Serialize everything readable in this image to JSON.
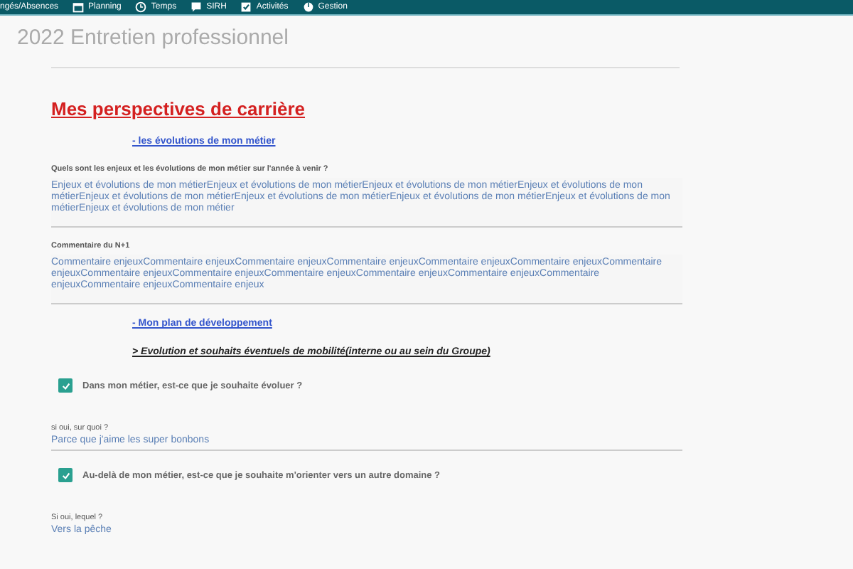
{
  "nav": {
    "items": [
      {
        "label": "ngés/Absences"
      },
      {
        "label": "Planning"
      },
      {
        "label": "Temps"
      },
      {
        "label": "SIRH"
      },
      {
        "label": "Activités"
      },
      {
        "label": "Gestion"
      }
    ]
  },
  "page_title": "2022 Entretien professionnel",
  "heading": "Mes perspectives de carrière",
  "blocks": [
    {
      "kind": "link",
      "text": "- les évolutions de mon métier"
    },
    {
      "kind": "textarea",
      "label": "Quels sont les enjeux et les évolutions de mon métier sur l'année à venir ?",
      "value": "Enjeux et évolutions de mon métierEnjeux et évolutions de mon métierEnjeux et évolutions de mon métierEnjeux et évolutions de mon métierEnjeux et évolutions de mon métierEnjeux et évolutions de mon métierEnjeux et évolutions de mon métierEnjeux et évolutions de mon métierEnjeux et évolutions de mon métier"
    },
    {
      "kind": "textarea",
      "label": "Commentaire du N+1",
      "value": "Commentaire enjeuxCommentaire enjeuxCommentaire enjeuxCommentaire enjeuxCommentaire enjeuxCommentaire enjeuxCommentaire enjeuxCommentaire enjeuxCommentaire enjeuxCommentaire enjeuxCommentaire enjeuxCommentaire enjeuxCommentaire enjeuxCommentaire enjeuxCommentaire enjeux"
    },
    {
      "kind": "link",
      "text": "- Mon plan de développement"
    },
    {
      "kind": "subheading",
      "text": "> Evolution et souhaits éventuels de mobilité(interne ou au sein du Groupe)"
    },
    {
      "kind": "checkbox",
      "text": "Dans mon métier, est-ce que je souhaite évoluer ?",
      "checked": true
    },
    {
      "kind": "field",
      "label": "si oui, sur quoi ?",
      "value": "Parce que j'aime les super bonbons"
    },
    {
      "kind": "checkbox",
      "text": "Au-delà de mon métier, est-ce que je souhaite m'orienter vers un autre domaine ?",
      "checked": true
    },
    {
      "kind": "field",
      "label": "Si oui, lequel ?",
      "value": "Vers la pêche"
    }
  ]
}
